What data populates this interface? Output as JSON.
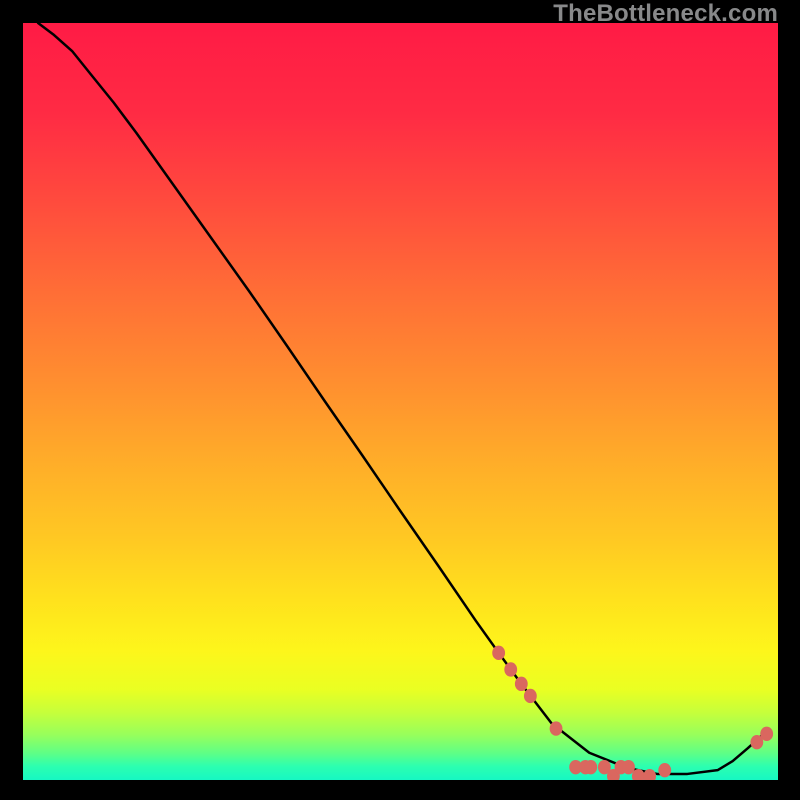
{
  "watermark": "TheBottleneck.com",
  "colors": {
    "gradient": {
      "stops": [
        {
          "offset": 0,
          "color": "#ff1b45"
        },
        {
          "offset": 12,
          "color": "#ff2b44"
        },
        {
          "offset": 24,
          "color": "#ff4c3d"
        },
        {
          "offset": 36,
          "color": "#ff6f36"
        },
        {
          "offset": 48,
          "color": "#ff902f"
        },
        {
          "offset": 58,
          "color": "#ffad29"
        },
        {
          "offset": 68,
          "color": "#ffc823"
        },
        {
          "offset": 76,
          "color": "#ffe11d"
        },
        {
          "offset": 83,
          "color": "#fdf61b"
        },
        {
          "offset": 88,
          "color": "#eaff22"
        },
        {
          "offset": 91,
          "color": "#c7ff3a"
        },
        {
          "offset": 94,
          "color": "#98ff5b"
        },
        {
          "offset": 96.5,
          "color": "#5dff87"
        },
        {
          "offset": 98.2,
          "color": "#2cffb0"
        },
        {
          "offset": 100,
          "color": "#16f7c3"
        }
      ]
    },
    "line": "#000000",
    "marker": "#da675f",
    "frame": "#000000"
  },
  "chart_data": {
    "type": "line",
    "title": "",
    "xlabel": "",
    "ylabel": "",
    "xlim": [
      0,
      100
    ],
    "ylim": [
      0,
      100
    ],
    "series": [
      {
        "name": "curve",
        "x": [
          2.0,
          4.0,
          6.5,
          9.0,
          12.0,
          15.0,
          20.0,
          25.0,
          30.0,
          35.0,
          40.0,
          45.0,
          50.0,
          55.0,
          60.0,
          63.0,
          66.0,
          70.0,
          75.0,
          80.0,
          84.0,
          88.0,
          92.0,
          94.0,
          96.0,
          98.0
        ],
        "y": [
          100.0,
          98.5,
          96.3,
          93.2,
          89.5,
          85.5,
          78.5,
          71.5,
          64.5,
          57.3,
          50.0,
          42.8,
          35.5,
          28.3,
          21.0,
          16.8,
          12.7,
          7.5,
          3.6,
          1.6,
          0.8,
          0.8,
          1.3,
          2.5,
          4.2,
          6.0
        ]
      }
    ],
    "markers": [
      {
        "x": 63.0,
        "y": 16.8
      },
      {
        "x": 64.6,
        "y": 14.6
      },
      {
        "x": 66.0,
        "y": 12.7
      },
      {
        "x": 67.2,
        "y": 11.1
      },
      {
        "x": 70.6,
        "y": 6.8
      },
      {
        "x": 73.2,
        "y": 1.7
      },
      {
        "x": 74.5,
        "y": 1.7
      },
      {
        "x": 75.2,
        "y": 1.7
      },
      {
        "x": 77.0,
        "y": 1.7
      },
      {
        "x": 78.2,
        "y": 0.5
      },
      {
        "x": 79.2,
        "y": 1.7
      },
      {
        "x": 80.2,
        "y": 1.7
      },
      {
        "x": 81.5,
        "y": 0.5
      },
      {
        "x": 83.0,
        "y": 0.5
      },
      {
        "x": 85.0,
        "y": 1.3
      },
      {
        "x": 97.2,
        "y": 5.0
      },
      {
        "x": 98.5,
        "y": 6.1
      }
    ]
  }
}
